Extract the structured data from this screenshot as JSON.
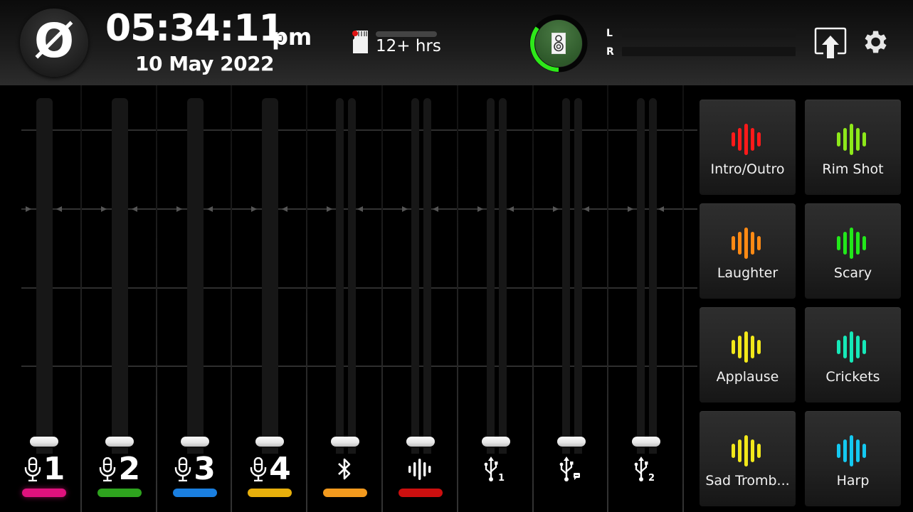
{
  "header": {
    "logo_glyph": "Ø",
    "time": "05:34:11",
    "ampm": "pm",
    "date": "10 May 2022",
    "recording": {
      "icon": "sd-card-icon",
      "battery_fraction": 1.0,
      "remaining_label": "12+ hrs"
    },
    "speaker": {
      "icon": "speaker-icon",
      "level_fraction": 0.35,
      "ring_color": "#2ee81a",
      "inner_color": "#3d6b37"
    },
    "meters": {
      "left_label": "L",
      "right_label": "R",
      "left_level": 0,
      "right_level": 0
    },
    "actions": [
      {
        "name": "share-upload",
        "icon": "upload-screen-icon"
      },
      {
        "name": "settings",
        "icon": "gear-icon"
      }
    ]
  },
  "channels": [
    {
      "id": "mic1",
      "icon": "microphone-icon",
      "number": "1",
      "color": "#e0127e",
      "stereo": false,
      "fader_level": 0
    },
    {
      "id": "mic2",
      "icon": "microphone-icon",
      "number": "2",
      "color": "#2ea31e",
      "stereo": false,
      "fader_level": 0
    },
    {
      "id": "mic3",
      "icon": "microphone-icon",
      "number": "3",
      "color": "#1a7fe0",
      "stereo": false,
      "fader_level": 0
    },
    {
      "id": "mic4",
      "icon": "microphone-icon",
      "number": "4",
      "color": "#e8b00c",
      "stereo": false,
      "fader_level": 0
    },
    {
      "id": "bluetooth",
      "icon": "bluetooth-icon",
      "number": "",
      "color": "#f39a1e",
      "stereo": true,
      "fader_level": 0
    },
    {
      "id": "sound-pads",
      "icon": "soundwave-icon",
      "number": "",
      "color": "#cc0f0f",
      "stereo": true,
      "fader_level": 0
    },
    {
      "id": "usb1",
      "icon": "usb-icon",
      "number": "",
      "sub": "1",
      "color": "",
      "stereo": true,
      "fader_level": 0
    },
    {
      "id": "usb-chat",
      "icon": "usb-chat-icon",
      "number": "",
      "sub": "chat",
      "color": "",
      "stereo": true,
      "fader_level": 0
    },
    {
      "id": "usb2",
      "icon": "usb-icon",
      "number": "",
      "sub": "2",
      "color": "",
      "stereo": true,
      "fader_level": 0
    }
  ],
  "pads": [
    {
      "label": "Intro/Outro",
      "color": "#ff1a1a"
    },
    {
      "label": "Rim Shot",
      "color": "#8de81a"
    },
    {
      "label": "Laughter",
      "color": "#ff8a14"
    },
    {
      "label": "Scary",
      "color": "#22e81a"
    },
    {
      "label": "Applause",
      "color": "#f2e81a"
    },
    {
      "label": "Crickets",
      "color": "#16e8b8"
    },
    {
      "label": "Sad Tromb...",
      "color": "#f2e81a"
    },
    {
      "label": "Harp",
      "color": "#14c8f0"
    }
  ]
}
